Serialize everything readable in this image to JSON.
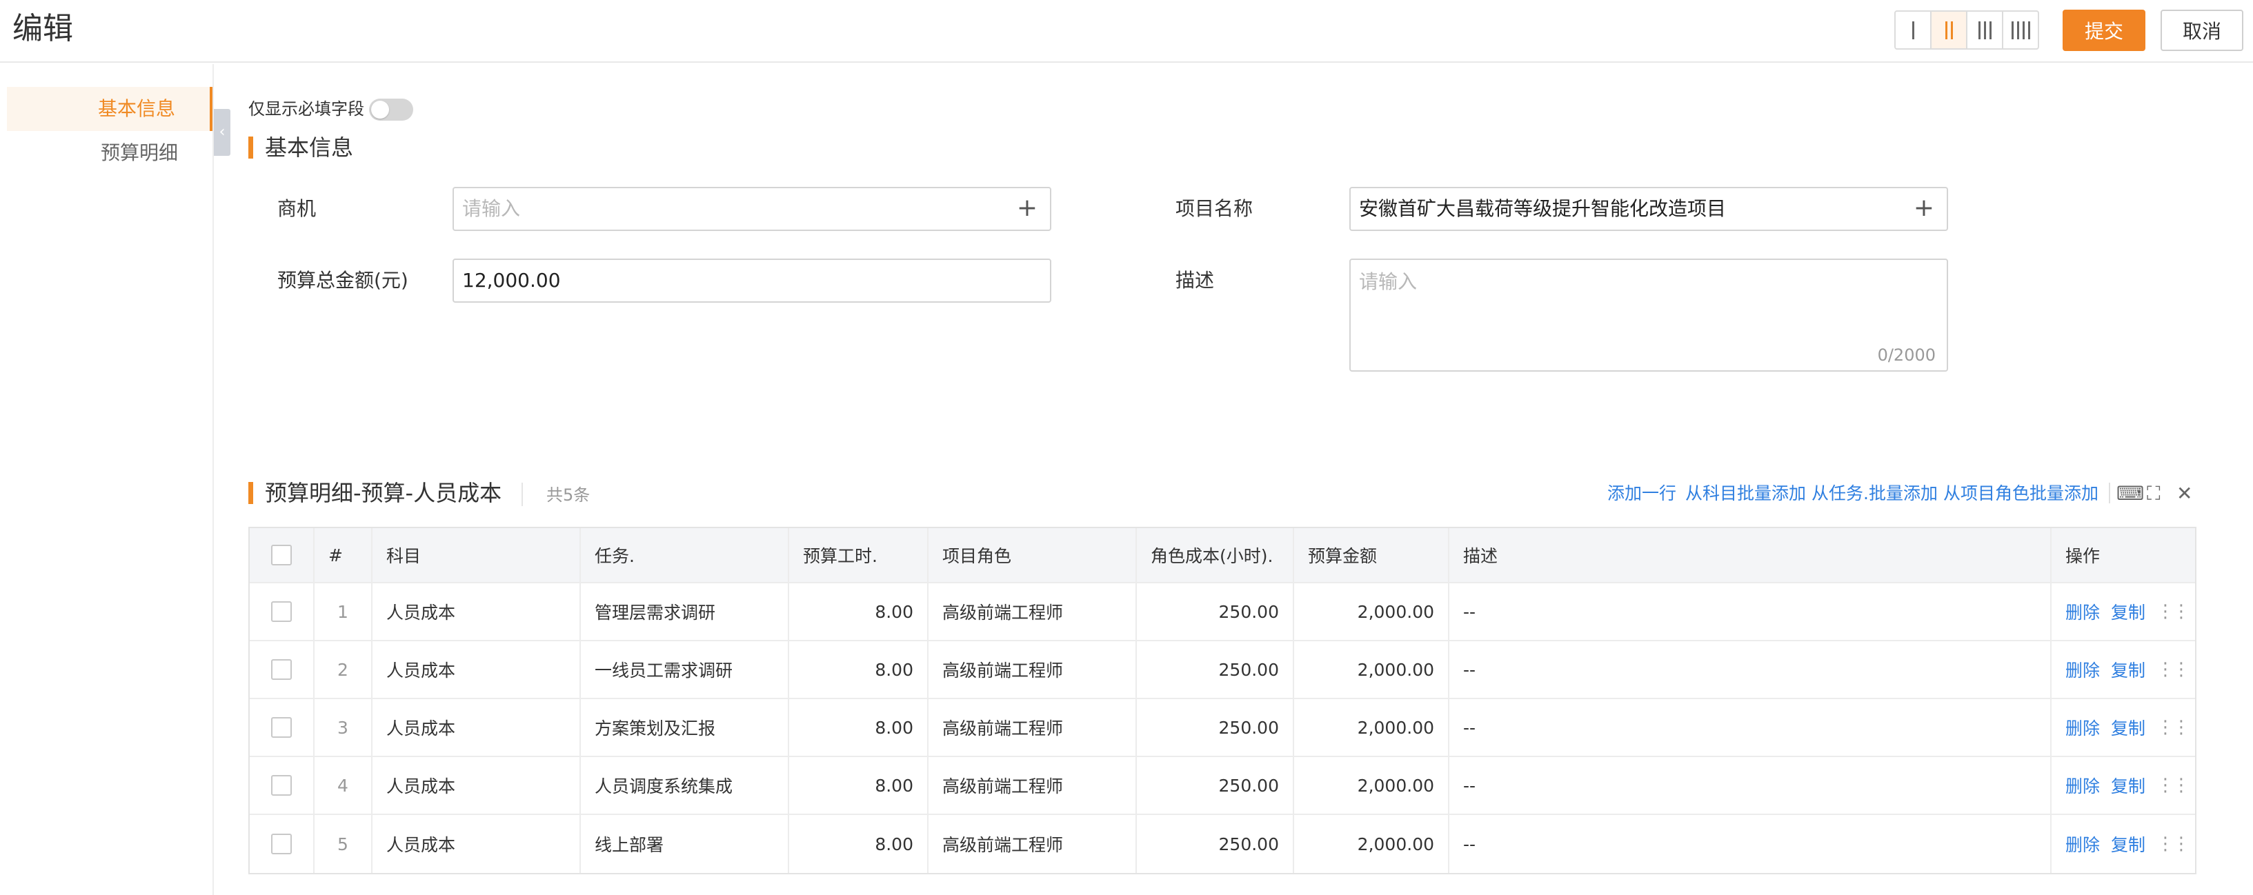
{
  "header": {
    "title": "编辑",
    "submit_label": "提交",
    "cancel_label": "取消"
  },
  "sidebar": {
    "items": [
      {
        "label": "基本信息",
        "active": true
      },
      {
        "label": "预算明细",
        "active": false
      }
    ]
  },
  "form": {
    "required_only_label": "仅显示必填字段",
    "section_title": "基本信息",
    "opportunity": {
      "label": "商机",
      "placeholder": "请输入",
      "value": ""
    },
    "project_name": {
      "label": "项目名称",
      "value": "安徽首矿大昌载荷等级提升智能化改造项目"
    },
    "budget_total": {
      "label": "预算总金额(元)",
      "value": "12,000.00"
    },
    "description": {
      "label": "描述",
      "placeholder": "请输入",
      "counter": "0/2000"
    }
  },
  "budget": {
    "section_title": "预算明细-预算-人员成本",
    "count": "共5条",
    "actions": {
      "add_row": "添加一行",
      "batch_subject": "从科目批量添加",
      "batch_task": "从任务.批量添加",
      "batch_role": "从项目角色批量添加"
    },
    "columns": [
      "#",
      "科目",
      "任务.",
      "预算工时.",
      "项目角色",
      "角色成本(小时).",
      "预算金额",
      "描述",
      "操作"
    ],
    "row_ops": {
      "delete": "删除",
      "copy": "复制"
    },
    "rows": [
      {
        "index": "1",
        "subject": "人员成本",
        "task": "管理层需求调研",
        "hours": "8.00",
        "role": "高级前端工程师",
        "role_cost": "250.00",
        "amount": "2,000.00",
        "description": "--"
      },
      {
        "index": "2",
        "subject": "人员成本",
        "task": "一线员工需求调研",
        "hours": "8.00",
        "role": "高级前端工程师",
        "role_cost": "250.00",
        "amount": "2,000.00",
        "description": "--"
      },
      {
        "index": "3",
        "subject": "人员成本",
        "task": "方案策划及汇报",
        "hours": "8.00",
        "role": "高级前端工程师",
        "role_cost": "250.00",
        "amount": "2,000.00",
        "description": "--"
      },
      {
        "index": "4",
        "subject": "人员成本",
        "task": "人员调度系统集成",
        "hours": "8.00",
        "role": "高级前端工程师",
        "role_cost": "250.00",
        "amount": "2,000.00",
        "description": "--"
      },
      {
        "index": "5",
        "subject": "人员成本",
        "task": "线上部署",
        "hours": "8.00",
        "role": "高级前端工程师",
        "role_cost": "250.00",
        "amount": "2,000.00",
        "description": "--"
      }
    ]
  },
  "icons": {
    "column_layout": [
      "layout-1-column-icon",
      "layout-2-column-icon",
      "layout-3-column-icon",
      "layout-4-column-icon"
    ],
    "table_tools": [
      "keyboard-icon",
      "fullscreen-icon",
      "close-icon"
    ],
    "row_drag": "drag-handle-icon"
  },
  "colors": {
    "accent": "#f18424",
    "link": "#2f7fe0"
  }
}
